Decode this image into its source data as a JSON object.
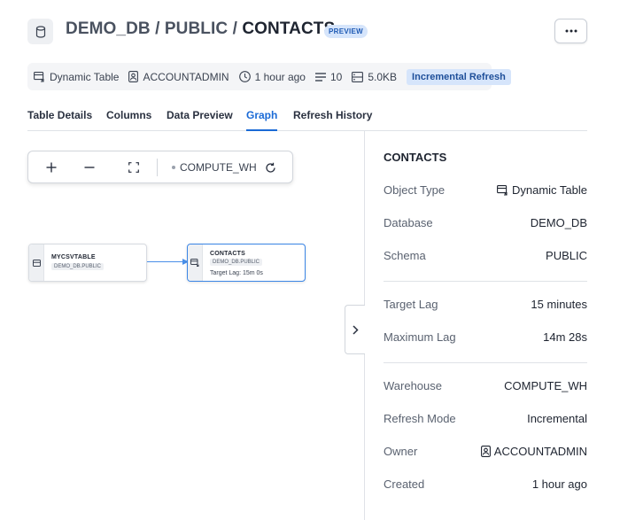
{
  "header": {
    "breadcrumb_db": "DEMO_DB",
    "sep1": " / ",
    "breadcrumb_schema": "PUBLIC",
    "sep2": " / ",
    "table_name": "CONTACTS",
    "preview_badge": "PREVIEW",
    "more_label": "···",
    "icon": "database-icon"
  },
  "meta": {
    "type": "Dynamic Table",
    "owner": "ACCOUNTADMIN",
    "updated": "1 hour ago",
    "rows": "10",
    "size": "5.0KB",
    "refresh_badge": "Incremental Refresh"
  },
  "tabs": [
    {
      "label": "Table Details"
    },
    {
      "label": "Columns"
    },
    {
      "label": "Data Preview"
    },
    {
      "label": "Graph",
      "active": true
    },
    {
      "label": "Refresh History"
    }
  ],
  "toolbar": {
    "zoom_in": "+",
    "zoom_out": "−",
    "fit_icon": "fit-screen-icon",
    "warehouse": "COMPUTE_WH",
    "refresh_icon": "refresh-icon"
  },
  "graph": {
    "source": {
      "title": "MYCSVTABLE",
      "sub": "DEMO_DB.PUBLIC"
    },
    "target": {
      "title": "CONTACTS",
      "sub": "DEMO_DB.PUBLIC",
      "lag": "Target Lag: 15m 0s"
    }
  },
  "panel": {
    "title": "CONTACTS",
    "object_type": {
      "key": "Object Type",
      "value": "Dynamic Table"
    },
    "database": {
      "key": "Database",
      "value": "DEMO_DB"
    },
    "schema": {
      "key": "Schema",
      "value": "PUBLIC"
    },
    "target_lag": {
      "key": "Target Lag",
      "value": "15 minutes"
    },
    "max_lag": {
      "key": "Maximum Lag",
      "value": "14m 28s"
    },
    "warehouse": {
      "key": "Warehouse",
      "value": "COMPUTE_WH"
    },
    "refresh_mode": {
      "key": "Refresh Mode",
      "value": "Incremental"
    },
    "owner": {
      "key": "Owner",
      "value": "ACCOUNTADMIN"
    },
    "created": {
      "key": "Created",
      "value": "1 hour ago"
    }
  },
  "colors": {
    "accent": "#1a6ad6",
    "badge_bg": "#d6e5fb",
    "edge": "#4a8fe8"
  }
}
